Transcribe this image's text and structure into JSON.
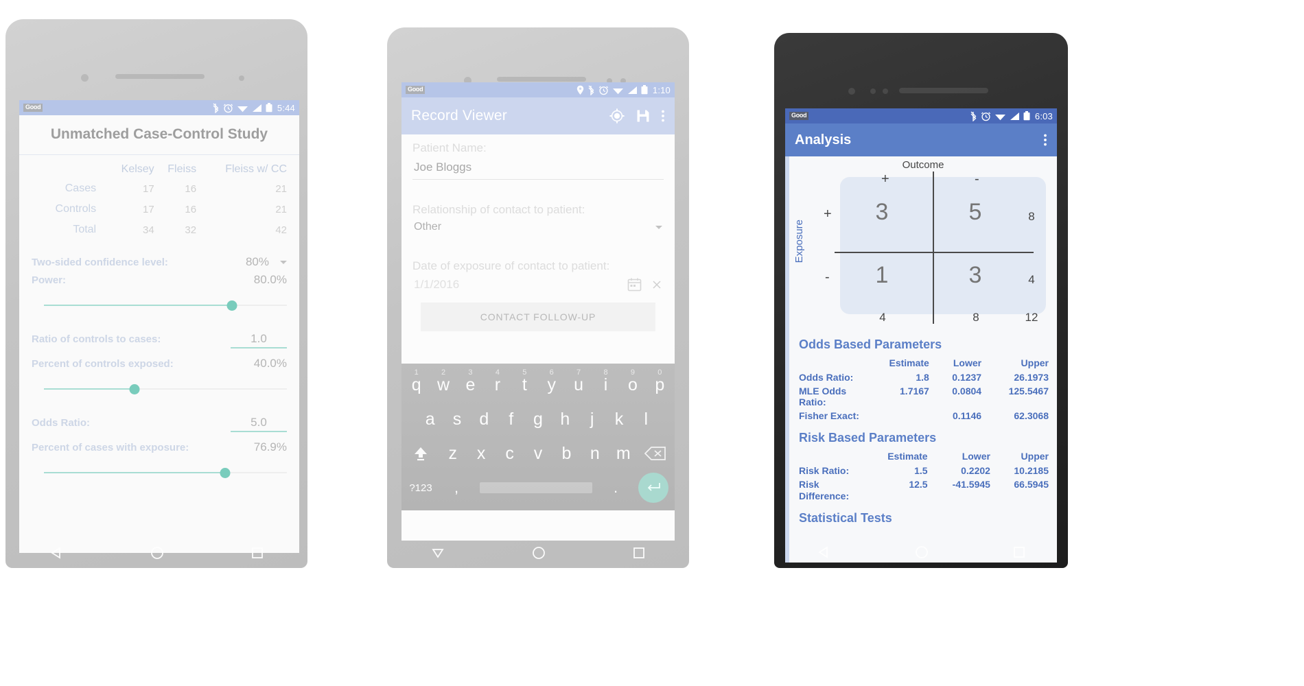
{
  "phone1": {
    "status": {
      "carrier": "Good",
      "time": "5:44",
      "icons": [
        "bluetooth-icon",
        "alarm-icon",
        "wifi-icon",
        "signal-icon",
        "battery-icon"
      ]
    },
    "title": "Unmatched Case-Control Study",
    "table": {
      "columns": [
        "",
        "Kelsey",
        "Fleiss",
        "Fleiss w/ CC"
      ],
      "rows": [
        {
          "label": "Cases",
          "values": [
            "17",
            "16",
            "21"
          ]
        },
        {
          "label": "Controls",
          "values": [
            "17",
            "16",
            "21"
          ]
        },
        {
          "label": "Total",
          "values": [
            "34",
            "32",
            "42"
          ]
        }
      ]
    },
    "controls": [
      {
        "label": "Two-sided confidence level:",
        "value": "80%",
        "kind": "spinner"
      },
      {
        "label": "Power:",
        "value": "80.0%",
        "kind": "slider",
        "percent": 80
      },
      {
        "label": "Ratio of controls to cases:",
        "value": "1.0",
        "kind": "field"
      },
      {
        "label": "Percent of controls exposed:",
        "value": "40.0%",
        "kind": "slider",
        "percent": 40
      },
      {
        "label": "Odds Ratio:",
        "value": "5.0",
        "kind": "field"
      },
      {
        "label": "Percent of cases with exposure:",
        "value": "76.9%",
        "kind": "slider",
        "percent": 77
      }
    ],
    "nav": [
      "back-icon",
      "home-icon",
      "recents-icon"
    ]
  },
  "phone2": {
    "status": {
      "carrier": "Good",
      "time": "1:10",
      "icons": [
        "location-icon",
        "bluetooth-icon",
        "alarm-icon",
        "wifi-icon",
        "signal-icon",
        "battery-icon"
      ]
    },
    "appbar": {
      "title": "Record Viewer",
      "actions": [
        "gps-fixed-icon",
        "save-icon",
        "overflow-menu-icon"
      ]
    },
    "form": [
      {
        "label": "Patient Name:",
        "value": "Joe Bloggs",
        "kind": "text"
      },
      {
        "label": "Relationship of contact to patient:",
        "value": "Other",
        "kind": "select"
      },
      {
        "label": "Date of exposure of contact to patient:",
        "value": "1/1/2016",
        "kind": "date"
      }
    ],
    "button": "CONTACT FOLLOW-UP",
    "keyboard": {
      "row1": [
        {
          "k": "q",
          "n": "1"
        },
        {
          "k": "w",
          "n": "2"
        },
        {
          "k": "e",
          "n": "3"
        },
        {
          "k": "r",
          "n": "4"
        },
        {
          "k": "t",
          "n": "5"
        },
        {
          "k": "y",
          "n": "6"
        },
        {
          "k": "u",
          "n": "7"
        },
        {
          "k": "i",
          "n": "8"
        },
        {
          "k": "o",
          "n": "9"
        },
        {
          "k": "p",
          "n": "0"
        }
      ],
      "row2": [
        "a",
        "s",
        "d",
        "f",
        "g",
        "h",
        "j",
        "k",
        "l"
      ],
      "row3_shift": "shift-icon",
      "row3": [
        "z",
        "x",
        "c",
        "v",
        "b",
        "n",
        "m"
      ],
      "row3_delete": "backspace-icon",
      "row4_symbols": "?123",
      "row4_comma": ",",
      "row4_period": ".",
      "row4_enter": "enter-icon"
    },
    "nav": [
      "back-icon",
      "home-icon",
      "recents-icon"
    ]
  },
  "phone3": {
    "status": {
      "carrier": "Good",
      "time": "6:03",
      "icons": [
        "bluetooth-icon",
        "alarm-icon",
        "wifi-icon",
        "signal-icon",
        "battery-icon"
      ]
    },
    "appbar": {
      "title": "Analysis",
      "actions": [
        "overflow-menu-icon"
      ]
    },
    "matrix": {
      "outcome_label": "Outcome",
      "exposure_label": "Exposure",
      "outcome_signs": [
        "+",
        "-"
      ],
      "exposure_signs": [
        "+",
        "-"
      ],
      "cells": [
        [
          "3",
          "5"
        ],
        [
          "1",
          "3"
        ]
      ],
      "row_totals": [
        "8",
        "4"
      ],
      "col_totals": [
        "4",
        "8"
      ],
      "grand_total": "12"
    },
    "sections": [
      {
        "title": "Odds Based Parameters",
        "headers": [
          "",
          "Estimate",
          "Lower",
          "Upper"
        ],
        "rows": [
          {
            "label": "Odds Ratio:",
            "estimate": "1.8",
            "lower": "0.1237",
            "upper": "26.1973"
          },
          {
            "label": "MLE Odds Ratio:",
            "estimate": "1.7167",
            "lower": "0.0804",
            "upper": "125.5467"
          },
          {
            "label": "Fisher Exact:",
            "estimate": "",
            "lower": "0.1146",
            "upper": "62.3068"
          }
        ]
      },
      {
        "title": "Risk Based Parameters",
        "headers": [
          "",
          "Estimate",
          "Lower",
          "Upper"
        ],
        "rows": [
          {
            "label": "Risk Ratio:",
            "estimate": "1.5",
            "lower": "0.2202",
            "upper": "10.2185"
          },
          {
            "label": "Risk Difference:",
            "estimate": "12.5",
            "lower": "-41.5945",
            "upper": "66.5945"
          }
        ]
      },
      {
        "title": "Statistical Tests",
        "headers": [],
        "rows": []
      }
    ],
    "nav": [
      "back-icon",
      "home-icon",
      "recents-icon"
    ]
  },
  "colors": {
    "phone1_status": "#b6c5e8",
    "phone2_appbar": "#ccd6ee",
    "phone3_appbar": "#5b7fc7",
    "phone3_status": "#4a69b8",
    "slider_accent": "#79ccbc",
    "matrix_cell_bg": "#e2e9f4",
    "stat_text": "#4a6fbc"
  }
}
